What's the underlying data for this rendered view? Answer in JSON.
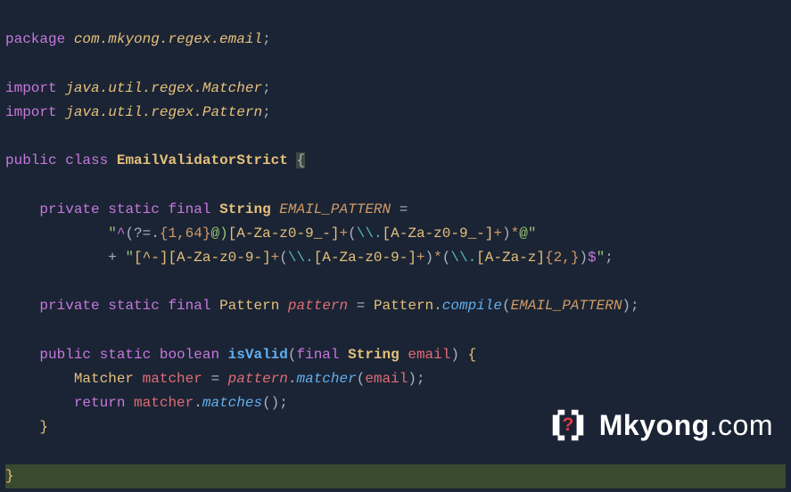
{
  "code": {
    "package_kw": "package",
    "package_path": "com.mkyong.regex.email",
    "import_kw": "import",
    "import1": "java.util.regex.Matcher",
    "import2": "java.util.regex.Pattern",
    "public": "public",
    "class_kw": "class",
    "classname": "EmailValidatorStrict",
    "private": "private",
    "static": "static",
    "final": "final",
    "string_type": "String",
    "pattern_const": "EMAIL_PATTERN",
    "regex_line1_open": "\"",
    "regex_line1_a": "^",
    "regex_line1_b": "(?=.",
    "regex_line1_c": "{",
    "regex_line1_d": "1",
    "regex_line1_e": ",",
    "regex_line1_f": "64",
    "regex_line1_g": "}",
    "regex_line1_h": "@)",
    "regex_line1_i": "[A-Za-z0-9_-]",
    "regex_line1_j": "+",
    "regex_line1_k": "(",
    "regex_line1_l": "\\\\.",
    "regex_line1_m": "[A-Za-z0-9_-]",
    "regex_line1_n": "+",
    "regex_line1_o": ")",
    "regex_line1_p": "*",
    "regex_line1_q": "@",
    "regex_line1_close": "\"",
    "plus": "+",
    "regex_line2_open": "\"",
    "regex_line2_a": "[^-]",
    "regex_line2_b": "[A-Za-z0-9-]",
    "regex_line2_c": "+",
    "regex_line2_d": "(",
    "regex_line2_e": "\\\\.",
    "regex_line2_f": "[A-Za-z0-9-]",
    "regex_line2_g": "+",
    "regex_line2_h": ")",
    "regex_line2_i": "*",
    "regex_line2_j": "(",
    "regex_line2_k": "\\\\.",
    "regex_line2_l": "[A-Za-z]",
    "regex_line2_m": "{",
    "regex_line2_n": "2",
    "regex_line2_o": ",",
    "regex_line2_p": "}",
    "regex_line2_q": ")",
    "regex_line2_r": "$",
    "regex_line2_close": "\"",
    "pattern_type": "Pattern",
    "pattern_field": "pattern",
    "compile": "compile",
    "boolean": "boolean",
    "isvalid": "isValid",
    "email_param": "email",
    "matcher_type": "Matcher",
    "matcher_var": "matcher",
    "matcher_method": "matcher",
    "return": "return",
    "matches": "matches",
    "eq": " = ",
    "semi": ";"
  },
  "watermark": {
    "brand_bold": "Mkyong",
    "brand_tail": ".com"
  }
}
